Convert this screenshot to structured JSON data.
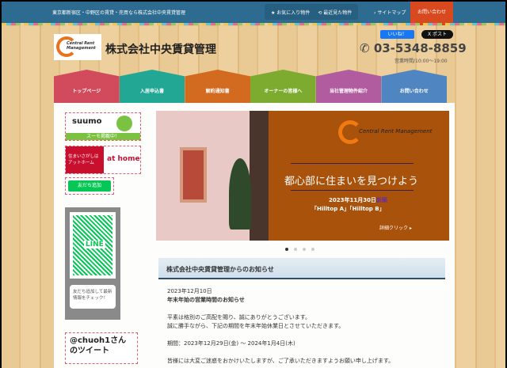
{
  "topbar": {
    "tagline": "東京都新宿区・中野区の賃貸・売買なら株式会社中央賃貸管理",
    "favorites": "お気に入り物件",
    "recent": "最近見た物件",
    "sitemap": "サイトマップ",
    "contact": "お問い合わせ"
  },
  "header": {
    "logo_text": "Central Rent Management",
    "site_name": "株式会社中央賃貸管理",
    "like": "いいね！",
    "post": "X ポスト",
    "phone": "03-5348-8859",
    "hours": "営業時間/10:00〜19:00"
  },
  "nav": [
    {
      "label": "トップページ",
      "color": "#d24b5c"
    },
    {
      "label": "入居申込書",
      "color": "#21a793"
    },
    {
      "label": "解約通知書",
      "color": "#d26a1f"
    },
    {
      "label": "オーナーの皆様へ",
      "color": "#7cab2f"
    },
    {
      "label": "当社管理物件紹介",
      "color": "#b15c9f"
    },
    {
      "label": "お問い合わせ",
      "color": "#4f86c1"
    }
  ],
  "sidebar": {
    "suumo": "suumo",
    "suumo_sub": "スーモ掲載中！",
    "athome_left": "住まいさがしは アットホーム",
    "athome": "at home",
    "line_add": "友だち追加",
    "qr_label": "LINE",
    "qr_caption": "友だち追加して最新情報をチェック！",
    "tweet_title": "@chuoh1さんのツイート"
  },
  "slider": {
    "logo_text": "Central Rent Management",
    "slogan": "都心部に住まいを見つけよう",
    "date": "2023年11月30日",
    "new": "新築",
    "names": "「Hilltop A」「Hilltop B」",
    "more": "詳細クリック ▸",
    "slides": 4,
    "active": 1
  },
  "news": {
    "heading": "株式会社中央賃貸管理からのお知らせ",
    "lines": [
      "2023年12月10日",
      "年末年始の営業時間のお知らせ",
      "",
      "平素は格別のご高配を賜り、誠にありがとうございます。",
      "誠に勝手ながら、下記の期間を年末年始休業日とさせていただきます。",
      "",
      "期間：2023年12月29日(金) 〜 2024年1月4日(木)",
      "",
      "皆様には大変ご迷惑をおかけいたしますが、ご了承いただきますようお願い申し上げます。"
    ]
  }
}
